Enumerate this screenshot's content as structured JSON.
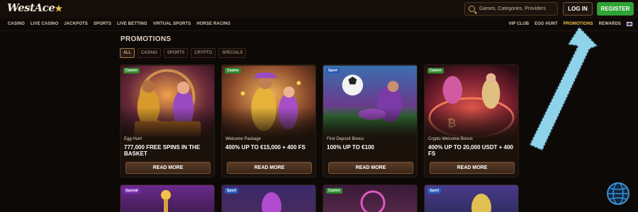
{
  "header": {
    "logo_text": "WestAce",
    "search_placeholder": "Games, Categories, Providers",
    "login_label": "LOG IN",
    "register_label": "REGISTER"
  },
  "nav": {
    "left": [
      "CASINO",
      "LIVE CASINO",
      "JACKPOTS",
      "SPORTS",
      "LIVE BETTING",
      "VIRTUAL SPORTS",
      "HORSE RACING"
    ],
    "right": [
      "VIP CLUB",
      "EGG HUNT",
      "PROMOTIONS",
      "REWARDS"
    ],
    "active": "PROMOTIONS"
  },
  "page": {
    "title": "PROMOTIONS",
    "filters": [
      "ALL",
      "CASINO",
      "SPORTS",
      "CRYPTO",
      "SPECIALS"
    ],
    "active_filter": "ALL"
  },
  "cards": [
    {
      "tag": "Casino",
      "subtitle": "Egg Hunt",
      "headline": "777,000 FREE SPINS IN THE BASKET",
      "button": "READ MORE"
    },
    {
      "tag": "Casino",
      "subtitle": "Welcome Package",
      "headline": "400% UP TO €15,000 + 400 FS",
      "button": "READ MORE"
    },
    {
      "tag": "Sport",
      "subtitle": "First Deposit Bonus",
      "headline": "100% UP TO €100",
      "button": "READ MORE"
    },
    {
      "tag": "Casino",
      "subtitle": "Crypto Welcome Bonus",
      "headline": "400% UP TO 20,000 USDT + 400 FS",
      "button": "READ MORE"
    }
  ],
  "cards_row2": [
    {
      "tag": "Special"
    },
    {
      "tag": "Sport"
    },
    {
      "tag": "Casino"
    },
    {
      "tag": "Sport"
    }
  ],
  "colors": {
    "accent": "#f3c24a",
    "register": "#2fa336",
    "annotation_arrow": "#8fd3ea"
  },
  "icons": [
    "search-icon",
    "flag-uk-icon",
    "globe-icon",
    "arrow-annotation"
  ]
}
